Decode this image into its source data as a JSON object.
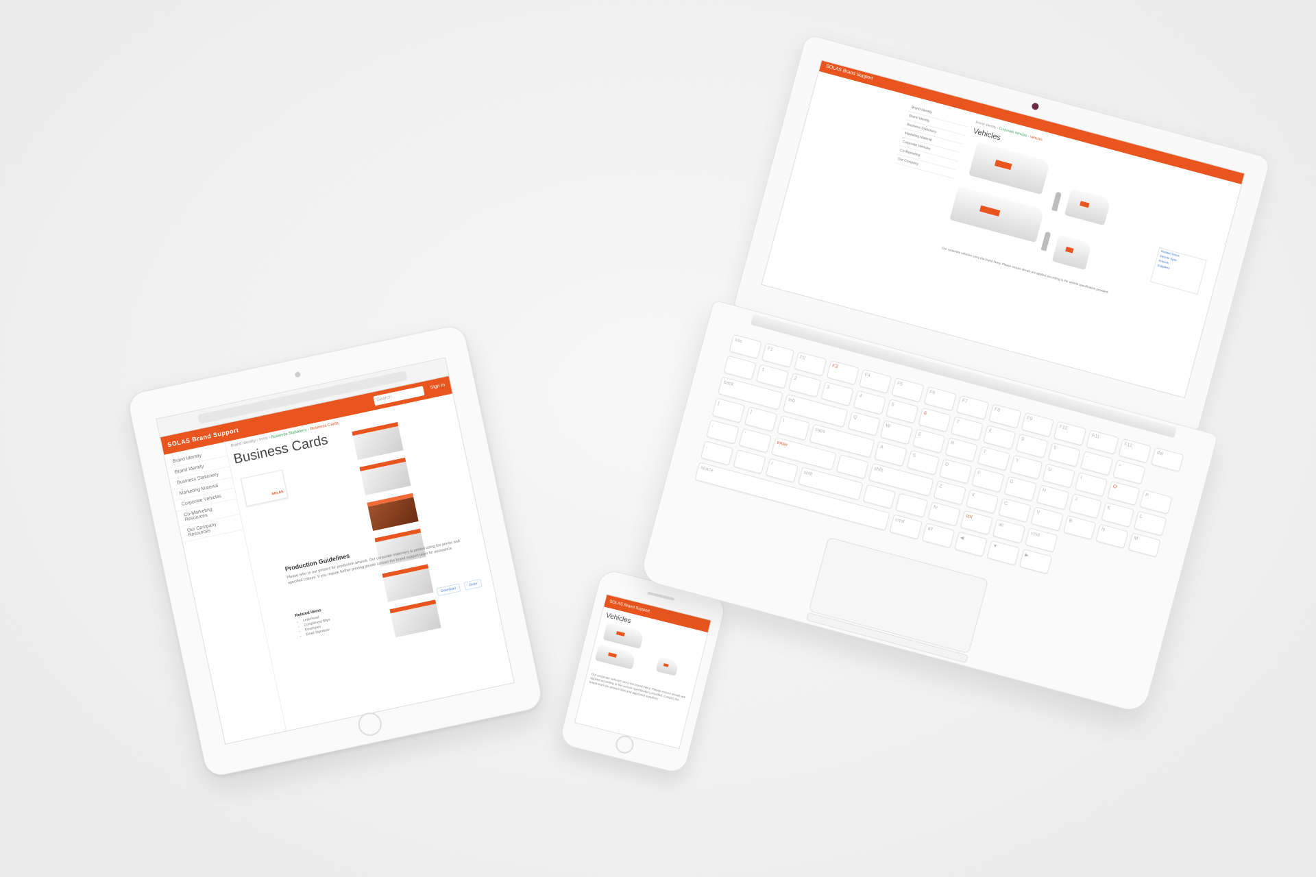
{
  "tablet": {
    "safari_url": "",
    "brand": "SOLAS  Brand Support",
    "search_placeholder": "Search",
    "sign_in": "Sign In",
    "sidebar": [
      "Brand Identity",
      "Brand Identity",
      "Business Stationery",
      "Marketing Material",
      "Corporate Vehicles",
      "Co-Marketing Resources",
      "Our Company Resources"
    ],
    "breadcrumbs": {
      "a": "Brand Identity",
      "b": "Print",
      "c": "Business Stationery",
      "d": "Business Cards"
    },
    "title": "Business Cards",
    "single_card_text": "SOLAS",
    "section_title": "Production Guidelines",
    "section_text": "Please refer to our printers for production artwork. Our corporate stationery is printed using the printer and specified colours. If you require further printing please contact the brand support team for assistance.",
    "related_title": "Related Items",
    "related_items": [
      "Letterhead",
      "Compliment Slips",
      "Envelopes",
      "Email Signature"
    ],
    "buttons": [
      "Download",
      "Order"
    ]
  },
  "phone": {
    "header": "SOLAS  Brand Support",
    "title": "Vehicles",
    "text": "Our corporate vehicles carry the brand livery. Please ensure decals are applied according to the vehicle specification provided. Contact the brand team for artwork files and approved suppliers."
  },
  "laptop": {
    "brand": "SOLAS  Brand Support",
    "sidebar": [
      "Brand Identity",
      "Brand Identity",
      "Business Stationery",
      "Marketing Material",
      "Corporate Vehicles",
      "Co-Marketing",
      "Our Company"
    ],
    "breadcrumbs": {
      "a": "Brand Identity",
      "b": "Corporate Vehicles",
      "c": "Vehicles"
    },
    "title": "Vehicles",
    "box_links": [
      "Related Items",
      "Vehicle Spec",
      "Artwork",
      "Suppliers"
    ],
    "text": "Our corporate vehicles carry the brand livery. Please ensure decals are applied according to the vehicle specification provided.",
    "keys": [
      "esc",
      "F1",
      "F2",
      "F3",
      "F4",
      "F5",
      "F6",
      "F7",
      "F8",
      "F9",
      "F10",
      "F11",
      "F12",
      "del",
      "`",
      "1",
      "2",
      "3",
      "4",
      "5",
      "6",
      "7",
      "8",
      "9",
      "0",
      "-",
      "=",
      "back",
      "tab",
      "Q",
      "W",
      "E",
      "R",
      "T",
      "Y",
      "U",
      "I",
      "O",
      "P",
      "[",
      "]",
      "\\",
      "caps",
      "A",
      "S",
      "D",
      "F",
      "G",
      "H",
      "J",
      "K",
      "L",
      ";",
      "'",
      "enter",
      "",
      "shift",
      "Z",
      "X",
      "C",
      "V",
      "B",
      "N",
      "M",
      ",",
      ".",
      "/",
      "shift",
      "",
      "",
      "fn",
      "ctrl",
      "alt",
      "cmd",
      "space",
      "cmd",
      "alt",
      "◀",
      "▼",
      "▶"
    ]
  }
}
